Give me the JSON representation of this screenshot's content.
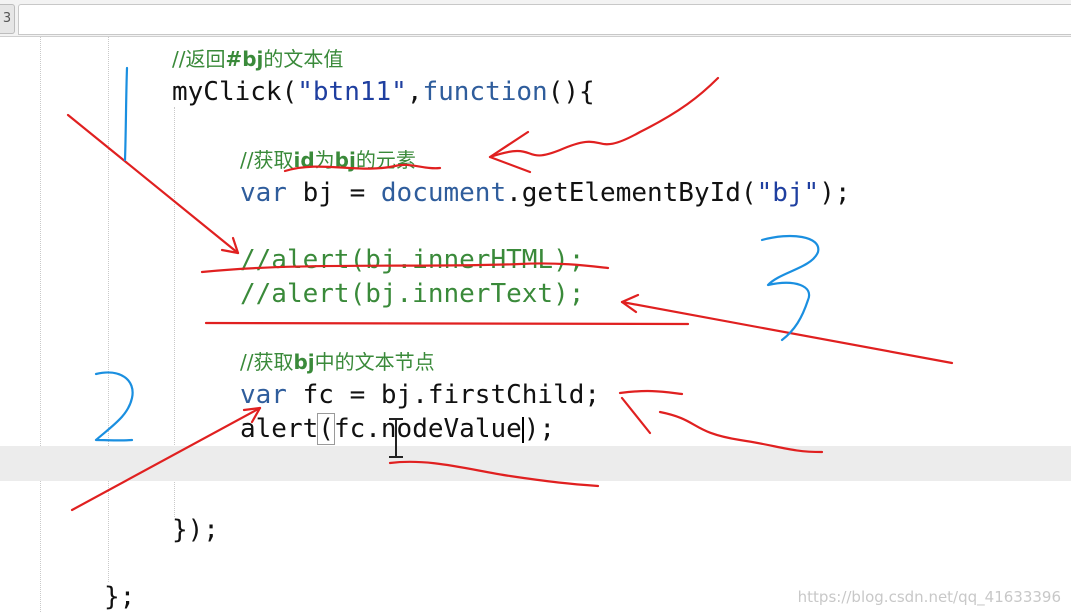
{
  "tabbar": {
    "tab_stub_label": "3"
  },
  "code_lines": [
    {
      "indent": "comment1",
      "text": "//返回#bj的文本值"
    },
    {
      "indent": "call",
      "text": "myClick(\"btn11\",function(){"
    },
    {
      "text": "//获取id为bj的元素"
    },
    {
      "text": "var bj = document.getElementById(\"bj\");"
    },
    {
      "text": "//alert(bj.innerHTML);"
    },
    {
      "text": "//alert(bj.innerText);"
    },
    {
      "text": "//获取bj中的文本节点"
    },
    {
      "text": "var fc = bj.firstChild;"
    },
    {
      "text": "alert(fc.nodeValue);"
    },
    {
      "text": "});"
    },
    {
      "text": "};"
    }
  ],
  "tokens": {
    "l1_a": "//返回",
    "l1_b": "#bj",
    "l1_c": "的文本值",
    "l2_a": "myClick(",
    "l2_b": "\"btn11\"",
    "l2_c": ",",
    "l2_d": "function",
    "l2_e": "(){",
    "l3_a": "//获取",
    "l3_b": "id",
    "l3_c": "为",
    "l3_d": "bj",
    "l3_e": "的元素",
    "l4_a": "var",
    "l4_b": " bj = ",
    "l4_c": "document",
    "l4_d": ".getElementById(",
    "l4_e": "\"bj\"",
    "l4_f": ");",
    "l5": "//alert(bj.innerHTML);",
    "l6": "//alert(bj.innerText);",
    "l7_a": "//获取",
    "l7_b": "bj",
    "l7_c": "中的文本节点",
    "l8_a": "var",
    "l8_b": " fc = bj.firstChild;",
    "l9_a": "alert",
    "l9_b": "(",
    "l9_c": "fc.nodeValue",
    "l9_d": ");",
    "l10": "});",
    "l11": "};"
  },
  "watermark": "https://blog.csdn.net/qq_41633396",
  "colors": {
    "comment": "#3a8a3a",
    "keyword": "#2f5d9c",
    "string": "#1f3fa0",
    "annotation_red": "#e02020",
    "annotation_blue": "#1a8fe0",
    "current_line": "#ececec"
  }
}
